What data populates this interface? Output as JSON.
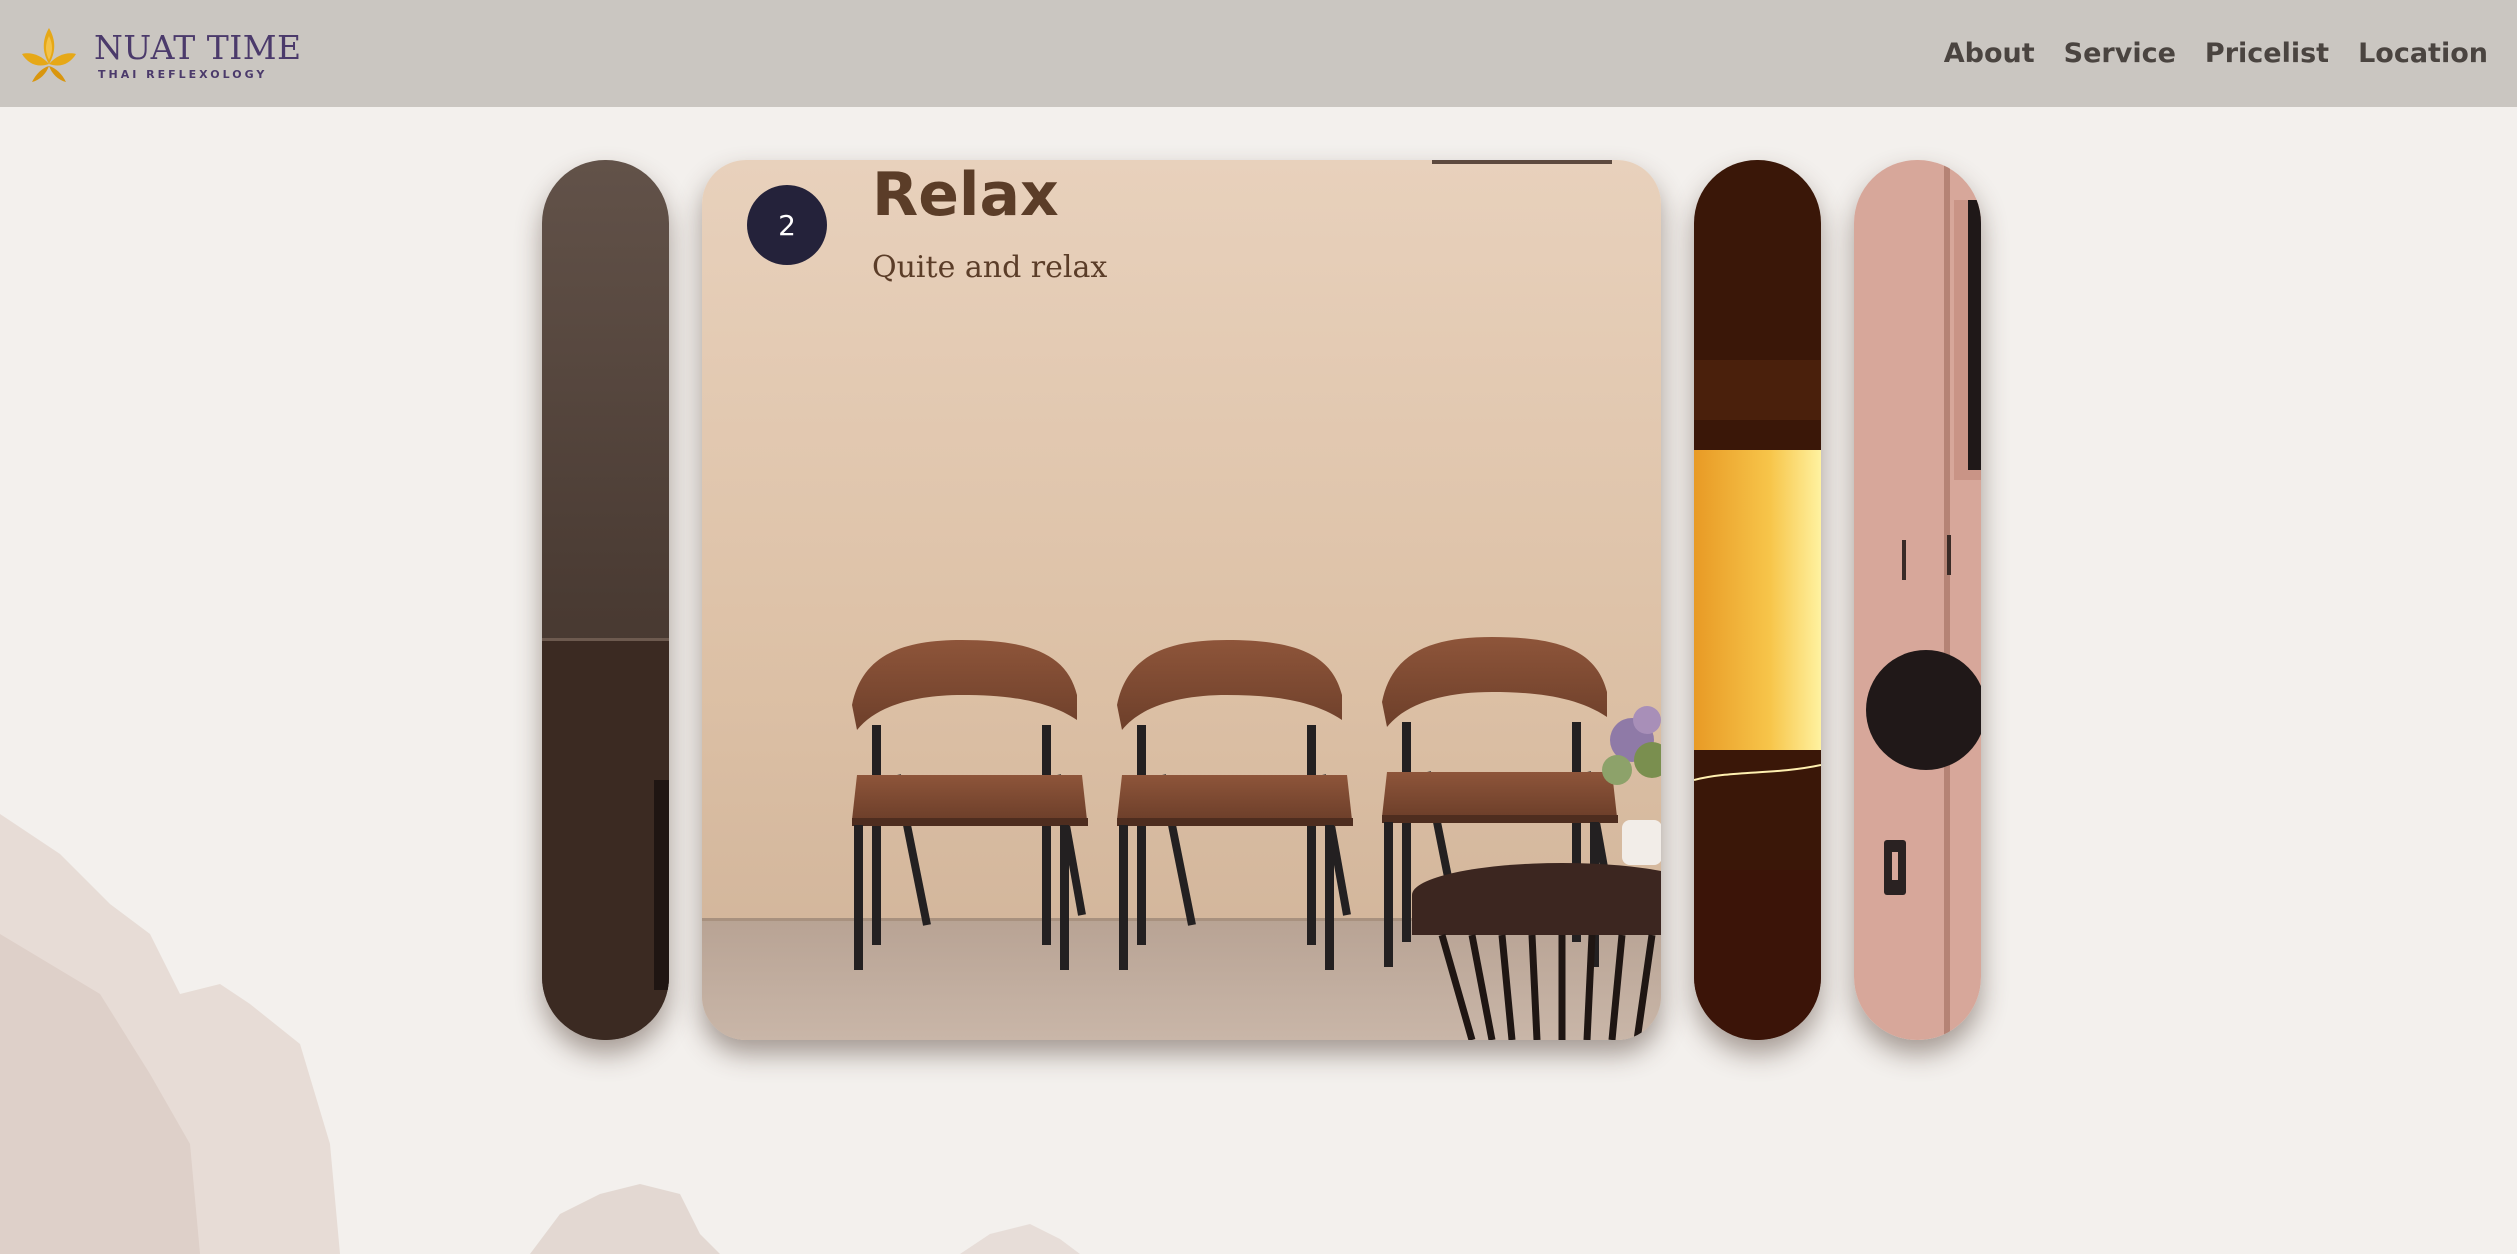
{
  "brand": {
    "name": "NUAT TIME",
    "tagline": "THAI REFLEXOLOGY",
    "logo_icon": "lotus-icon",
    "colors": {
      "gold": "#e6a817",
      "purple": "#4b3a6b"
    }
  },
  "nav": {
    "items": [
      {
        "label": "About"
      },
      {
        "label": "Service"
      },
      {
        "label": "Pricelist"
      },
      {
        "label": "Location"
      }
    ]
  },
  "carousel": {
    "active_index": 2,
    "active_slide": {
      "number": "2",
      "title": "Relax",
      "subtitle": "Quite and relax"
    },
    "colors": {
      "badge": "#24223a",
      "heading": "#5b3d28",
      "header_bg": "#cac6c1"
    }
  }
}
